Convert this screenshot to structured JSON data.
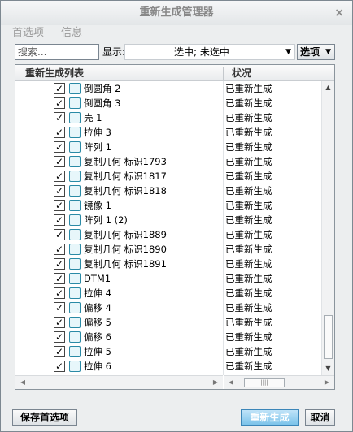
{
  "window": {
    "title": "重新生成管理器",
    "close": "×"
  },
  "menu": {
    "preferences": "首选项",
    "info": "信息"
  },
  "toolbar": {
    "search_placeholder": "搜索...",
    "show_label": "显示:",
    "show_value": "选中; 未选中",
    "options_label": "选项"
  },
  "list": {
    "col_name": "重新生成列表",
    "col_status": "状况",
    "rows": [
      {
        "name": "倒圆角 2",
        "status": "已重新生成",
        "checked": true,
        "icon": "round-icon"
      },
      {
        "name": "倒圆角 3",
        "status": "已重新生成",
        "checked": true,
        "icon": "round-icon"
      },
      {
        "name": "壳 1",
        "status": "已重新生成",
        "checked": true,
        "icon": "shell-icon"
      },
      {
        "name": "拉伸 3",
        "status": "已重新生成",
        "checked": true,
        "icon": "extrude-icon"
      },
      {
        "name": "阵列 1",
        "status": "已重新生成",
        "checked": true,
        "icon": "pattern-icon"
      },
      {
        "name": "复制几何 标识1793",
        "status": "已重新生成",
        "checked": true,
        "icon": "copy-geometry-icon"
      },
      {
        "name": "复制几何 标识1817",
        "status": "已重新生成",
        "checked": true,
        "icon": "copy-geometry-icon"
      },
      {
        "name": "复制几何 标识1818",
        "status": "已重新生成",
        "checked": true,
        "icon": "copy-geometry-icon"
      },
      {
        "name": "镜像 1",
        "status": "已重新生成",
        "checked": true,
        "icon": "mirror-icon"
      },
      {
        "name": "阵列 1 (2)",
        "status": "已重新生成",
        "checked": true,
        "icon": "pattern-icon"
      },
      {
        "name": "复制几何 标识1889",
        "status": "已重新生成",
        "checked": true,
        "icon": "copy-geometry-icon"
      },
      {
        "name": "复制几何 标识1890",
        "status": "已重新生成",
        "checked": true,
        "icon": "copy-geometry-icon"
      },
      {
        "name": "复制几何 标识1891",
        "status": "已重新生成",
        "checked": true,
        "icon": "copy-geometry-icon"
      },
      {
        "name": "DTM1",
        "status": "已重新生成",
        "checked": true,
        "icon": "datum-plane-icon"
      },
      {
        "name": "拉伸 4",
        "status": "已重新生成",
        "checked": true,
        "icon": "extrude-icon"
      },
      {
        "name": "偏移 4",
        "status": "已重新生成",
        "checked": true,
        "icon": "offset-icon"
      },
      {
        "name": "偏移 5",
        "status": "已重新生成",
        "checked": true,
        "icon": "offset-icon"
      },
      {
        "name": "偏移 6",
        "status": "已重新生成",
        "checked": true,
        "icon": "offset-icon"
      },
      {
        "name": "拉伸 5",
        "status": "已重新生成",
        "checked": true,
        "icon": "extrude-icon"
      },
      {
        "name": "拉伸 6",
        "status": "已重新生成",
        "checked": true,
        "icon": "extrude-icon"
      }
    ]
  },
  "buttons": {
    "save_prefs": "保存首选项",
    "regenerate": "重新生成",
    "cancel": "取消"
  },
  "colors": {
    "accent": "#7cc3ea",
    "icon": "#2a8aa6"
  }
}
